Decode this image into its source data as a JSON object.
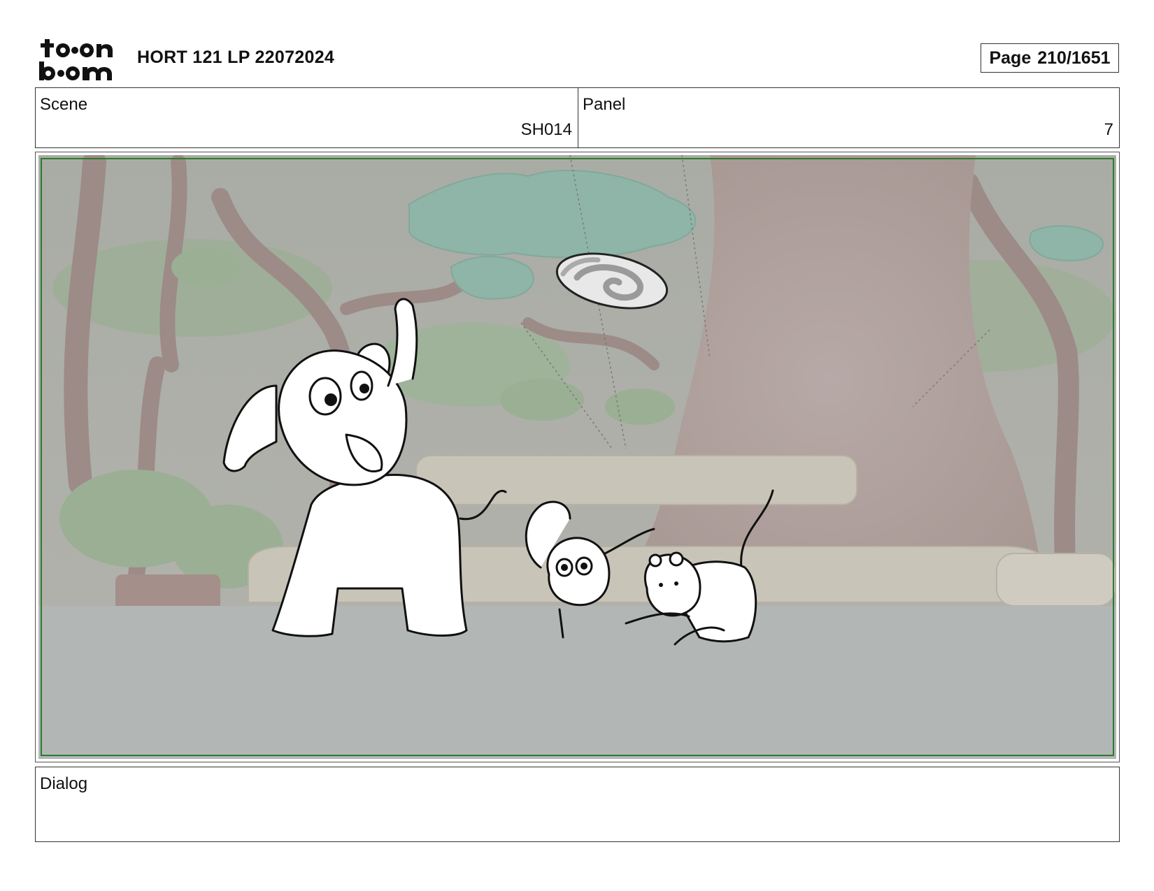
{
  "header": {
    "logo_name": "toonboom-logo",
    "project_title": "HORT 121 LP 22072024",
    "page_label": "Page",
    "page_number": "210/1651"
  },
  "scene": {
    "label": "Scene",
    "value": "SH014"
  },
  "panel": {
    "label": "Panel",
    "value": "7"
  },
  "artwork": {
    "description_icon": "storyboard-sketch-icon",
    "safe_area_color": "#2f7a2f"
  },
  "dialog": {
    "label": "Dialog",
    "text": ""
  }
}
